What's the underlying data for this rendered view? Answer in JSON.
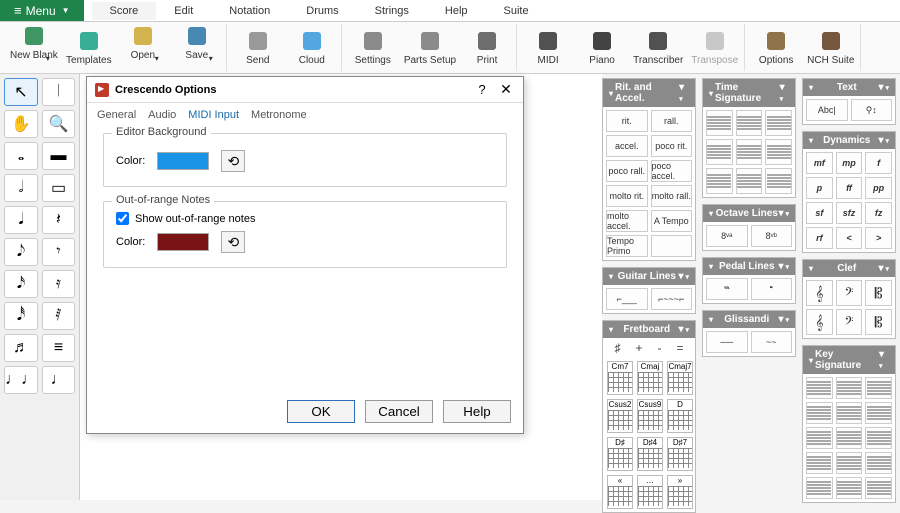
{
  "menu": {
    "menu_label": "Menu",
    "tabs": [
      "Score",
      "Edit",
      "Notation",
      "Drums",
      "Strings",
      "Help",
      "Suite"
    ],
    "active": 0
  },
  "ribbon": [
    {
      "label": "New Blank",
      "icon": "new",
      "drop": true
    },
    {
      "label": "Templates",
      "icon": "templates"
    },
    {
      "label": "Open",
      "icon": "open",
      "drop": true
    },
    {
      "label": "Save",
      "icon": "save",
      "drop": true
    },
    {
      "label": "Send",
      "icon": "send"
    },
    {
      "label": "Cloud",
      "icon": "cloud"
    },
    {
      "label": "Settings",
      "icon": "settings"
    },
    {
      "label": "Parts Setup",
      "icon": "parts"
    },
    {
      "label": "Print",
      "icon": "print"
    },
    {
      "label": "MIDI",
      "icon": "midi"
    },
    {
      "label": "Piano",
      "icon": "piano"
    },
    {
      "label": "Transcriber",
      "icon": "transcriber"
    },
    {
      "label": "Transpose",
      "icon": "transpose",
      "disabled": true
    },
    {
      "label": "Options",
      "icon": "options"
    },
    {
      "label": "NCH Suite",
      "icon": "suite"
    }
  ],
  "left_tools": [
    "↖",
    "𝄀",
    "✋",
    "🔍",
    "𝅝",
    "▬",
    "𝅗𝅥",
    "▭",
    "𝅘𝅥",
    "𝄽",
    "𝅘𝅥𝅮",
    "𝄾",
    "𝅘𝅥𝅯",
    "𝄿",
    "𝅘𝅥𝅰",
    "𝅀",
    "♬",
    "≡",
    "♩♩",
    "♩"
  ],
  "dialog": {
    "title": "Crescendo Options",
    "tabs": [
      "General",
      "Audio",
      "MIDI Input",
      "Metronome"
    ],
    "active_tab": 2,
    "fs1": {
      "legend": "Editor Background",
      "color_label": "Color:",
      "color": "#1993e6"
    },
    "fs2": {
      "legend": "Out-of-range Notes",
      "check_label": "Show out-of-range notes",
      "checked": true,
      "color_label": "Color:",
      "color": "#7a1313"
    },
    "buttons": {
      "ok": "OK",
      "cancel": "Cancel",
      "help": "Help"
    }
  },
  "panels": {
    "rit": {
      "title": "Rit. and Accel.",
      "items": [
        "rit.",
        "rall.",
        "accel.",
        "poco rit.",
        "poco rall.",
        "poco accel.",
        "molto rit.",
        "molto rall.",
        "molto accel.",
        "A Tempo",
        "Tempo Primo",
        ""
      ]
    },
    "guitar": {
      "title": "Guitar Lines"
    },
    "fret": {
      "title": "Fretboard",
      "ops": [
        "♯",
        "+",
        "-",
        "="
      ],
      "chords": [
        "Cm7",
        "Cmaj",
        "Cmaj7",
        "Csus2",
        "Csus9",
        "D",
        "D♯",
        "D♯4",
        "D♯7",
        "«",
        "…",
        "»"
      ]
    },
    "timesig": {
      "title": "Time Signature"
    },
    "octave": {
      "title": "Octave Lines",
      "items": [
        "8ᵛᵃ",
        "8ᵛᵇ"
      ]
    },
    "pedal": {
      "title": "Pedal Lines",
      "items": [
        "𝆮",
        "𝆯"
      ]
    },
    "gliss": {
      "title": "Glissandi"
    },
    "text": {
      "title": "Text",
      "items": [
        "Abc|",
        "⚲↕"
      ]
    },
    "dyn": {
      "title": "Dynamics",
      "items": [
        "mf",
        "mp",
        "f",
        "p",
        "ff",
        "pp",
        "sf",
        "sfz",
        "fz",
        "rf",
        "<",
        ">"
      ]
    },
    "clef": {
      "title": "Clef"
    },
    "keysig": {
      "title": "Key Signature"
    }
  }
}
